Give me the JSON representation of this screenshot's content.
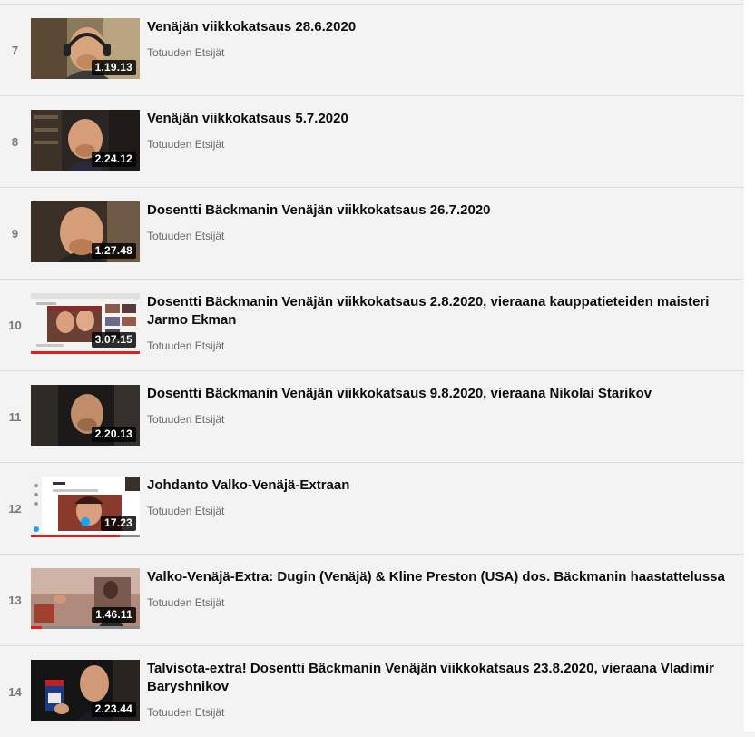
{
  "playlist": {
    "items": [
      {
        "index": "7",
        "title": "Venäjän viikkokatsaus 28.6.2020",
        "channel": "Totuuden Etsijät",
        "duration": "1.19.13",
        "thumbnail_icon": "headset-man-thumbnail"
      },
      {
        "index": "8",
        "title": "Venäjän viikkokatsaus 5.7.2020",
        "channel": "Totuuden Etsijät",
        "duration": "2.24.12",
        "thumbnail_icon": "man-bookshelf-thumbnail"
      },
      {
        "index": "9",
        "title": "Dosentti Bäckmanin Venäjän viikkokatsaus 26.7.2020",
        "channel": "Totuuden Etsijät",
        "duration": "1.27.48",
        "thumbnail_icon": "man-closeup-thumbnail"
      },
      {
        "index": "10",
        "title": "Dosentti Bäckmanin Venäjän viikkokatsaus 2.8.2020, vieraana kauppatieteiden maisteri Jarmo Ekman",
        "channel": "Totuuden Etsijät",
        "duration": "3.07.15",
        "thumbnail_icon": "screen-capture-thumbnail",
        "watched_fraction": 1.0
      },
      {
        "index": "11",
        "title": "Dosentti Bäckmanin Venäjän viikkokatsaus 9.8.2020, vieraana Nikolai Starikov",
        "channel": "Totuuden Etsijät",
        "duration": "2.20.13",
        "thumbnail_icon": "man-dim-room-thumbnail"
      },
      {
        "index": "12",
        "title": "Johdanto Valko-Venäjä-Extraan",
        "channel": "Totuuden Etsijät",
        "duration": "17.23",
        "thumbnail_icon": "social-feed-thumbnail",
        "watched_fraction": 0.82
      },
      {
        "index": "13",
        "title": "Valko-Venäjä-Extra: Dugin (Venäjä) & Kline Preston (USA) dos. Bäckmanin haastattelussa",
        "channel": "Totuuden Etsijät",
        "duration": "1.46.11",
        "thumbnail_icon": "interview-room-thumbnail",
        "watched_fraction": 0.1
      },
      {
        "index": "14",
        "title": "Talvisota-extra! Dosentti Bäckmanin Venäjän viikkokatsaus 23.8.2020, vieraana Vladimir Baryshnikov",
        "channel": "Totuuden Etsijät",
        "duration": "2.23.44",
        "thumbnail_icon": "man-holding-book-thumbnail"
      }
    ]
  },
  "colors": {
    "background": "#f3f3f3",
    "title_text": "#0c0c0c",
    "channel_text": "#6a6a6a",
    "index_text": "#7a7a7a",
    "progress_watched": "#e21d1d"
  }
}
